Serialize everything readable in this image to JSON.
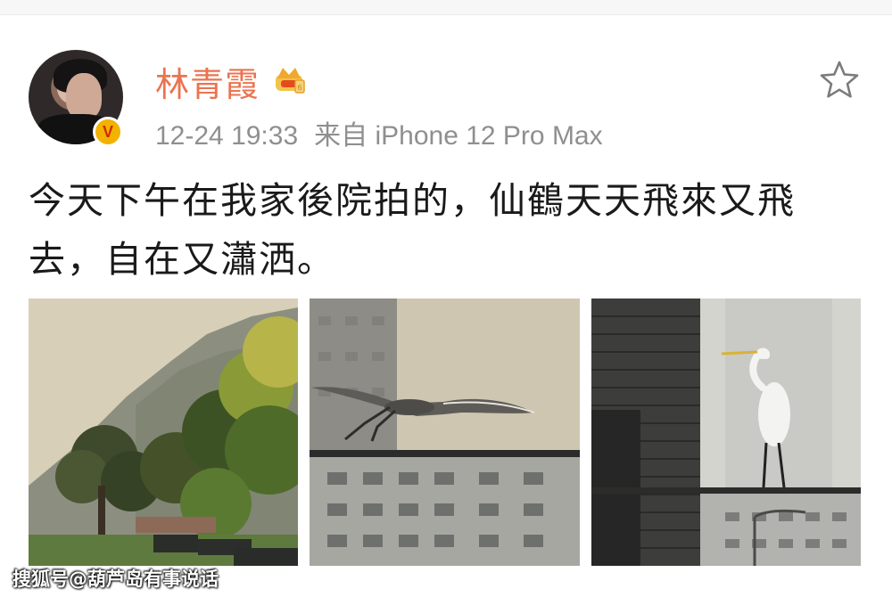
{
  "post": {
    "author": "林青霞",
    "time": "12-24 19:33",
    "source": "来自 iPhone 12 Pro Max",
    "text": "今天下午在我家後院拍的，仙鶴天天飛來又飛\n去，自在又瀟洒。"
  },
  "badges": {
    "verified": "V",
    "crown_icon": "crown-icon",
    "star_icon": "star-icon"
  },
  "photos": [
    {
      "name": "backyard-garden-photo"
    },
    {
      "name": "heron-flying-photo"
    },
    {
      "name": "heron-standing-photo"
    }
  ],
  "watermark": "搜狐号@葫芦岛有事说话",
  "colors": {
    "name": "#eb7350",
    "meta": "#8f8f8f",
    "text": "#1a1a1a",
    "verified_bg": "#f2b300",
    "verified_fg": "#d22b00"
  }
}
